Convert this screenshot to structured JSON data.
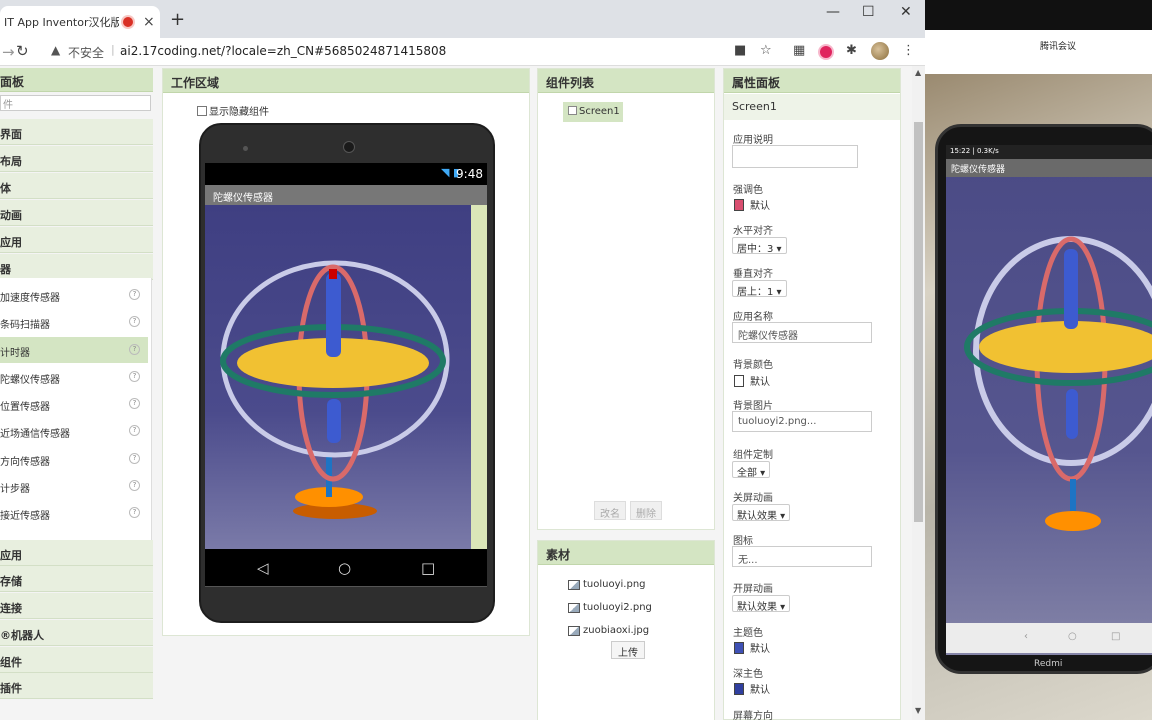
{
  "browser": {
    "tab_title": "IT App Inventor汉化版",
    "close": "×",
    "new_tab": "+",
    "win_min": "—",
    "win_max": "☐",
    "win_close": "✕",
    "security_label": "不安全",
    "url": "ai2.17coding.net/?locale=zh_CN#5685024871415808"
  },
  "palette": {
    "title": "面板",
    "search_placeholder": "件",
    "categories_top": [
      "界面",
      "布局",
      "体",
      "动画",
      "应用",
      "器"
    ],
    "sensors": [
      {
        "label": "加速度传感器",
        "selected": false
      },
      {
        "label": "条码扫描器",
        "selected": false
      },
      {
        "label": "计时器",
        "selected": true
      },
      {
        "label": "陀螺仪传感器",
        "selected": false
      },
      {
        "label": "位置传感器",
        "selected": false
      },
      {
        "label": "近场通信传感器",
        "selected": false
      },
      {
        "label": "方向传感器",
        "selected": false
      },
      {
        "label": "计步器",
        "selected": false
      },
      {
        "label": "接近传感器",
        "selected": false
      }
    ],
    "help_glyph": "?",
    "categories_bottom": [
      "应用",
      "存储",
      "连接",
      "®机器人",
      "组件",
      "插件"
    ]
  },
  "workspace": {
    "title": "工作区域",
    "show_hidden": "显示隐藏组件",
    "status_time": "9:48",
    "screen_title": "陀螺仪传感器"
  },
  "components": {
    "title": "组件列表",
    "root": "Screen1",
    "rename": "改名",
    "delete": "删除"
  },
  "media": {
    "title": "素材",
    "assets": [
      "tuoluoyi.png",
      "tuoluoyi2.png",
      "zuobiaoxi.jpg"
    ],
    "upload": "上传"
  },
  "properties": {
    "title": "属性面板",
    "component": "Screen1",
    "app_description_label": "应用说明",
    "accent_label": "强调色",
    "accent_value": "默认",
    "accent_color": "#d94f70",
    "halign_label": "水平对齐",
    "halign_value": "居中：3",
    "valign_label": "垂直对齐",
    "valign_value": "居上：1",
    "app_name_label": "应用名称",
    "app_name_value": "陀螺仪传感器",
    "bg_color_label": "背景颜色",
    "bg_color_value": "默认",
    "bg_color": "#ffffff",
    "bg_image_label": "背景图片",
    "bg_image_value": "tuoluoyi2.png...",
    "customize_label": "组件定制",
    "customize_value": "全部",
    "close_anim_label": "关屏动画",
    "close_anim_value": "默认效果",
    "icon_label": "图标",
    "icon_value": "无...",
    "open_anim_label": "开屏动画",
    "open_anim_value": "默认效果",
    "primary_label": "主题色",
    "primary_value": "默认",
    "primary_color": "#3f51b5",
    "primary_dark_label": "深主色",
    "primary_dark_value": "默认",
    "primary_dark_color": "#303f9f",
    "orientation_label": "屏幕方向"
  },
  "meeting": {
    "title": "腾讯会议",
    "phone_status": "15:22 | 0.3K/s",
    "phone_title": "陀螺仪传感器",
    "phone_brand": "Redmi"
  }
}
